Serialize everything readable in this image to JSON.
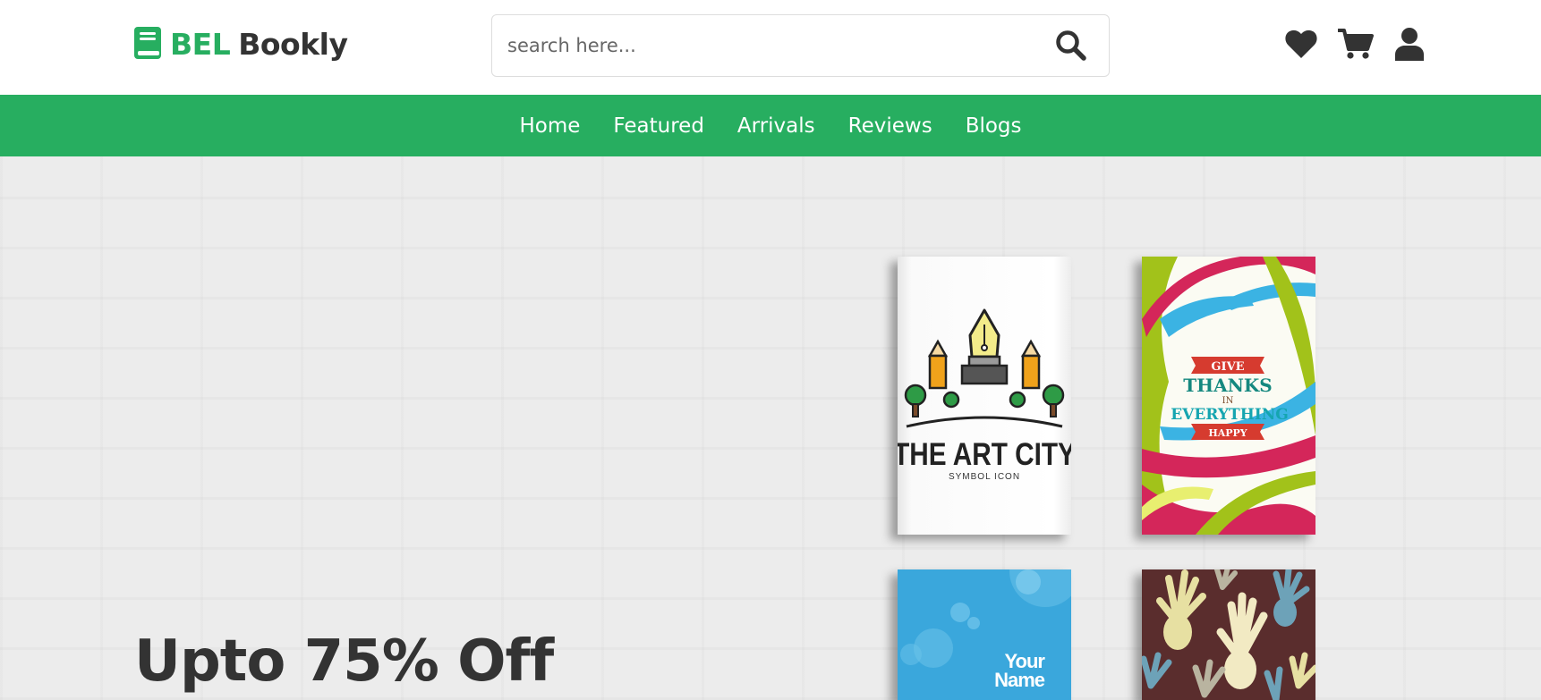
{
  "header": {
    "logo_brand": "BEL",
    "logo_name": "Bookly",
    "search_placeholder": "search here...",
    "icons": [
      "heart-icon",
      "cart-icon",
      "user-icon"
    ]
  },
  "nav": {
    "links": [
      "Home",
      "Featured",
      "Arrivals",
      "Reviews",
      "Blogs"
    ]
  },
  "hero": {
    "title": "Upto 75% Off",
    "books": [
      {
        "title": "THE ART CITY",
        "subtitle": "SYMBOL ICON"
      },
      {
        "line1": "GIVE",
        "line2": "THANKS",
        "line3": "IN",
        "line4": "EVERYTHING",
        "line5": "HAPPY"
      },
      {
        "text1": "Your",
        "text2": "Name"
      },
      {
        "theme": "hands"
      }
    ]
  },
  "colors": {
    "brand_green": "#27ae60",
    "dark_text": "#333333",
    "hero_bg": "#ececec"
  }
}
